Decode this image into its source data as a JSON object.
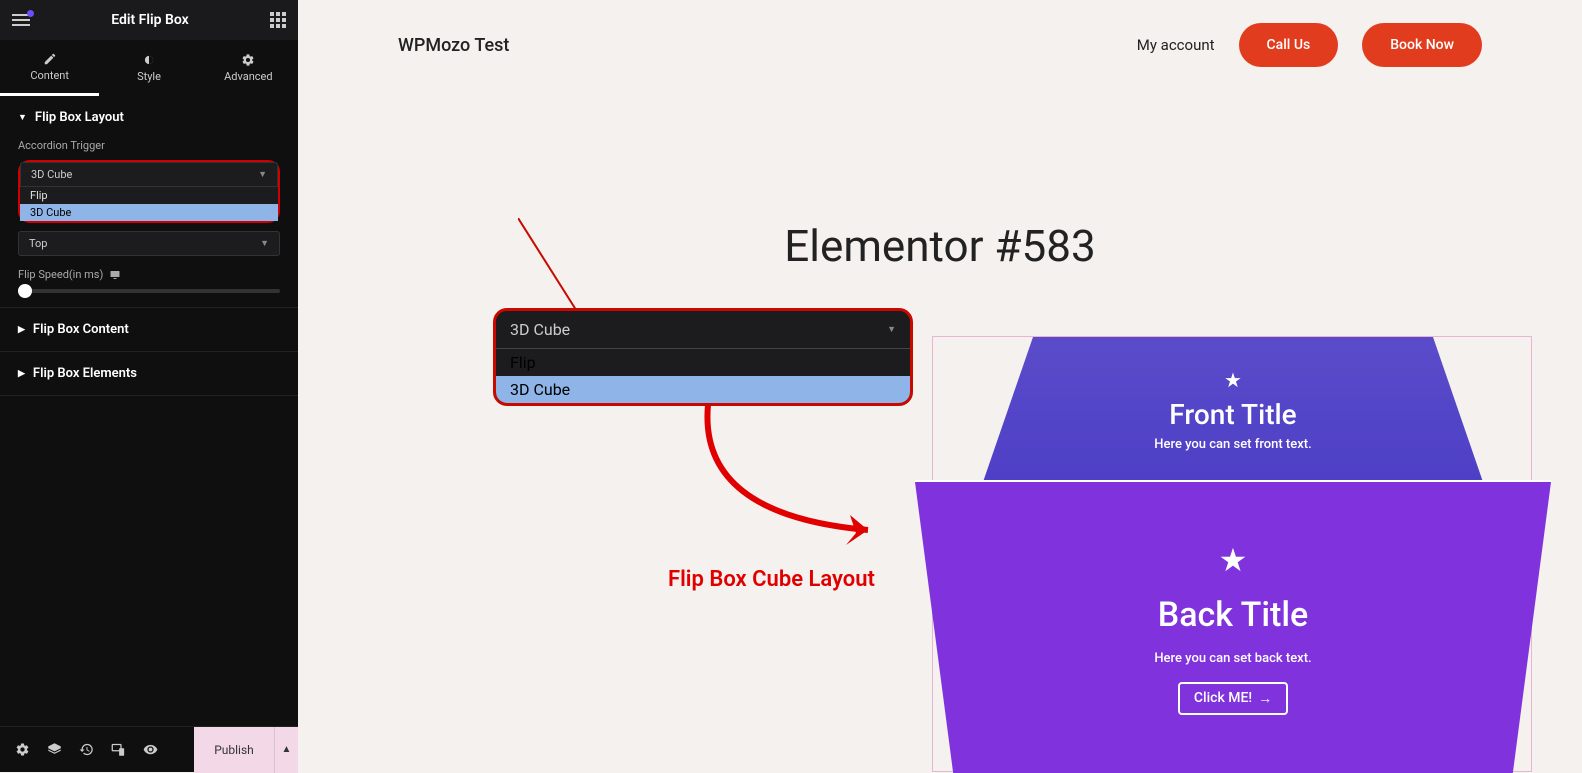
{
  "header": {
    "title": "Edit Flip Box"
  },
  "tabs": {
    "content": "Content",
    "style": "Style",
    "advanced": "Advanced"
  },
  "sections": {
    "layout": {
      "title": "Flip Box Layout",
      "trigger_label": "Accordion Trigger",
      "trigger_value": "3D Cube",
      "trigger_options": [
        "Flip",
        "3D Cube"
      ],
      "direction_value": "Top",
      "speed_label": "Flip Speed(in ms)"
    },
    "content": {
      "title": "Flip Box Content"
    },
    "elements": {
      "title": "Flip Box Elements"
    }
  },
  "bottom": {
    "publish": "Publish"
  },
  "canvas": {
    "brand": "WPMozo Test",
    "nav": {
      "account": "My account",
      "call": "Call Us",
      "book": "Book Now"
    },
    "page_title": "Elementor #583",
    "flipbox": {
      "front_title": "Front Title",
      "front_text": "Here you can set front text.",
      "back_title": "Back Title",
      "back_text": "Here you can set back text.",
      "button": "Click ME!"
    }
  },
  "callout": {
    "value": "3D Cube",
    "options": [
      "Flip",
      "3D Cube"
    ]
  },
  "annotation": "Flip Box Cube Layout"
}
